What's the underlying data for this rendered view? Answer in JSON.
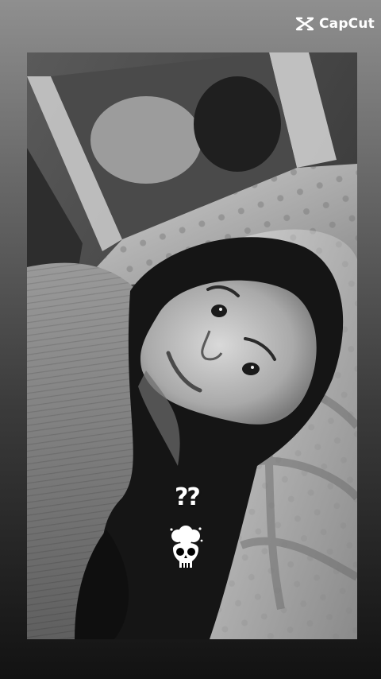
{
  "watermark": {
    "brand": "CapCut",
    "icon": "capcut-logo-icon"
  },
  "story": {
    "photo": "black-and-white-selfie-photo",
    "stickers": [
      {
        "type": "text",
        "text": "??"
      },
      {
        "type": "emoji",
        "icon": "exploding-head-skull-icon"
      }
    ]
  },
  "colors": {
    "background_top": "#8f8f8f",
    "background_bottom": "#121212",
    "watermark": "#ffffff"
  }
}
